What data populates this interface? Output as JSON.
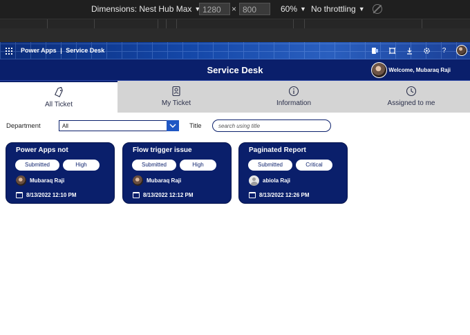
{
  "devtools": {
    "dimensions_label": "Dimensions: Nest Hub Max",
    "width_value": "1280",
    "times": "×",
    "height_value": "800",
    "zoom": "60%",
    "throttle": "No throttling"
  },
  "suite": {
    "app_name": "Power Apps",
    "separator": "|",
    "title": "Service Desk",
    "icons": [
      "office-icon",
      "screen-icon",
      "download-icon",
      "settings-icon",
      "help-icon",
      "avatar"
    ]
  },
  "header": {
    "title": "Service Desk",
    "welcome": "Welcome, Mubaraq Raji"
  },
  "tabs": [
    {
      "label": "All Ticket",
      "icon": "tag-icon",
      "active": true
    },
    {
      "label": "My Ticket",
      "icon": "badge-icon",
      "active": false
    },
    {
      "label": "Information",
      "icon": "info-icon",
      "active": false
    },
    {
      "label": "Assigned to me",
      "icon": "clock-icon",
      "active": false
    }
  ],
  "filters": {
    "department_label": "Department",
    "department_value": "All",
    "title_label": "Title",
    "search_placeholder": "search using title"
  },
  "tickets": [
    {
      "title": "Power Apps not",
      "status": "Submitted",
      "priority": "High",
      "user": "Mubaraq Raji",
      "date": "8/13/2022 12:10 PM"
    },
    {
      "title": "Flow trigger issue",
      "status": "Submitted",
      "priority": "High",
      "user": "Mubaraq Raji",
      "date": "8/13/2022 12:12 PM"
    },
    {
      "title": "Paginated Report",
      "status": "Submitted",
      "priority": "Critical",
      "user": "abiola Raji",
      "date": "8/13/2022 12:26 PM"
    }
  ],
  "colors": {
    "primary": "#0a1f6b",
    "accent": "#1f57c4",
    "tab_bg": "#d4d4d4"
  }
}
